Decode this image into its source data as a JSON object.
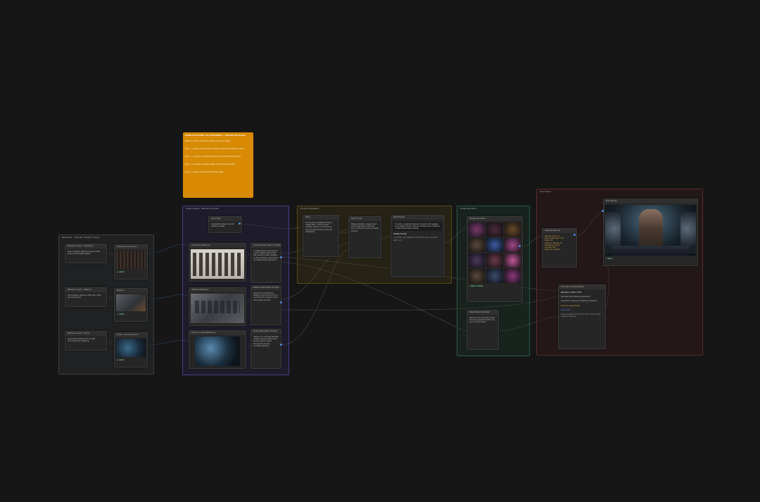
{
  "groups": {
    "references": {
      "title": "References · Character / Weapon / Scene",
      "color": "#3a3d40"
    },
    "analysis": {
      "title": "Image Analysis · Reference Prompts",
      "color": "#4a3f8a"
    },
    "prompt": {
      "title": "Prompt Composition",
      "color": "#8a6a1a"
    },
    "generation": {
      "title": "Image Generation",
      "color": "#2a5a45"
    },
    "output": {
      "title": "Final Output",
      "color": "#6a2a30"
    }
  },
  "note": {
    "title": "Unified Cinematic Sci-fi Workflow — Pipeline Overview",
    "lines": [
      "Reference inputs: character, weapon and scene images.",
      "Step 1 — Analyze each reference image and extract descriptive prompts.",
      "Step 2 — Compose a unified prompt from the extracted descriptions.",
      "Step 3 — Generate candidate images and pick the best result.",
      "Step 4 — Upscale and describe the final output."
    ]
  },
  "ref_nodes": [
    {
      "title": "Reference Input · Character",
      "text": "Load character reference sheet, outfit, pose and silhouette details.",
      "img_title": "Character Turnaround",
      "badge": "✔ Loaded"
    },
    {
      "title": "Reference Input · Weapon",
      "text": "Load weapon reference with gear, tools and accessories.",
      "img_title": "Weapon",
      "badge": "✔ Loaded"
    },
    {
      "title": "Reference Input · Scene",
      "text": "Load scene reference for cockpit environment and lighting.",
      "img_title": "Scene · Cockpit Interior",
      "badge": "✔ Loaded"
    }
  ],
  "analysis": {
    "input_title": "Input Title",
    "input_text": "Analyze the references and extract prompts.",
    "rows": [
      {
        "img_title": "Character Reference",
        "desc_title": "Character Description Prompt",
        "desc": "A rugged space mercenary in a worn leather flight jacket with layered straps, goggles on the forehead, scarred face and determined expression."
      },
      {
        "img_title": "Weapon Reference",
        "desc_title": "Weapon Description Prompt",
        "desc": "Assorted sci-fi sidearms, blasters and tools laid out on a workbench, brushed metal and orange accents."
      },
      {
        "img_title": "Scene / Cockpit Reference",
        "desc_title": "Scene Description Prompt",
        "desc": "Interior of a cramped starship cockpit, glowing instrument panels, nebula visible through the canopy, cinematic lighting."
      }
    ]
  },
  "prompt": {
    "story_title": "Story",
    "story_text": "A lone pilot navigates through a nebula storm, hands on the controls, tension on his face as warning lights flicker across the dashboard.",
    "combine_title": "Text Concat",
    "combine_text": "Merge character, weapon and scene descriptions with the story context into one cinematic prompt.",
    "final_title": "Text Preview",
    "final_text": "The pilot, a weathered space mercenary with goggles and a leather jacket, grips the controls of his cockpit as a violet nebula swirls outside.",
    "final_label": "Positive Prompt",
    "final_foot": "cinematic, ultra detailed, 35mm film still, volumetric light, sci-fi"
  },
  "generation": {
    "gallery_title": "Image Generation",
    "batch_label": "✔ Batch complete",
    "caption_title": "Select Best Candidate",
    "caption_text": "Pick the most cinematic result from the generated batch and send it to upscaling."
  },
  "output": {
    "upscale_title": "Upscale Settings",
    "upscale_lines": [
      "Upscale factor: 2x",
      "Denoise strength: 0.35",
      "Steps: 20",
      "Sampler: dpmpp_2m",
      "Scheduler: karras",
      "Tile size: 512",
      "Seam fix: enabled"
    ],
    "preview_title": "Final Render",
    "preview_badge": "✔ Saved",
    "summary_title": "Summary of Final Output",
    "summary_items": [
      "Resolution: 2048 x 1152",
      "Upscaled with detail enhancement",
      "Characters, setting and lighting consistent",
      "Saved to output folder"
    ],
    "summary_link": "View result",
    "summary_note": "Final cinematic frame of the pilot in the cockpit ready for delivery."
  },
  "colors": {
    "accent": "#d88a05",
    "link": "#4a8ad8",
    "wire": "#8a8a8a"
  }
}
